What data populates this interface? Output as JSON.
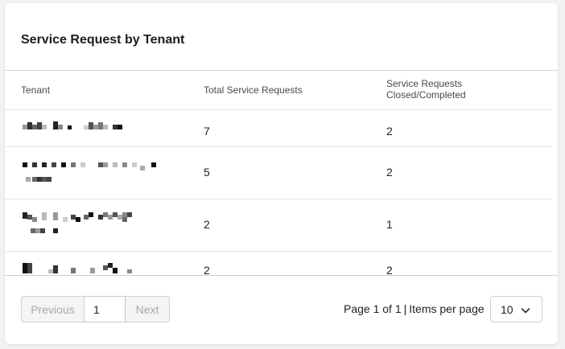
{
  "card": {
    "title": "Service Request by Tenant"
  },
  "table": {
    "columns": [
      "Tenant",
      "Total Service Requests",
      "Service Requests Closed/Completed"
    ],
    "columns_lines": {
      "col3_line1": "Service Requests",
      "col3_line2": "Closed/Completed"
    },
    "rows": [
      {
        "tenant": "",
        "total": "7",
        "closed": "2"
      },
      {
        "tenant": "",
        "total": "5",
        "closed": "2"
      },
      {
        "tenant": "",
        "total": "2",
        "closed": "1"
      },
      {
        "tenant": "",
        "total": "2",
        "closed": "2"
      }
    ]
  },
  "pagination": {
    "previous_label": "Previous",
    "next_label": "Next",
    "page_value": "1",
    "page_info": "Page 1 of 1",
    "items_per_page_label": "Items per page",
    "items_per_page_value": "10"
  },
  "colors": {
    "divider": "#d6d6d6",
    "disabled_text": "#a9a9a9",
    "disabled_bg": "#f4f4f5"
  }
}
